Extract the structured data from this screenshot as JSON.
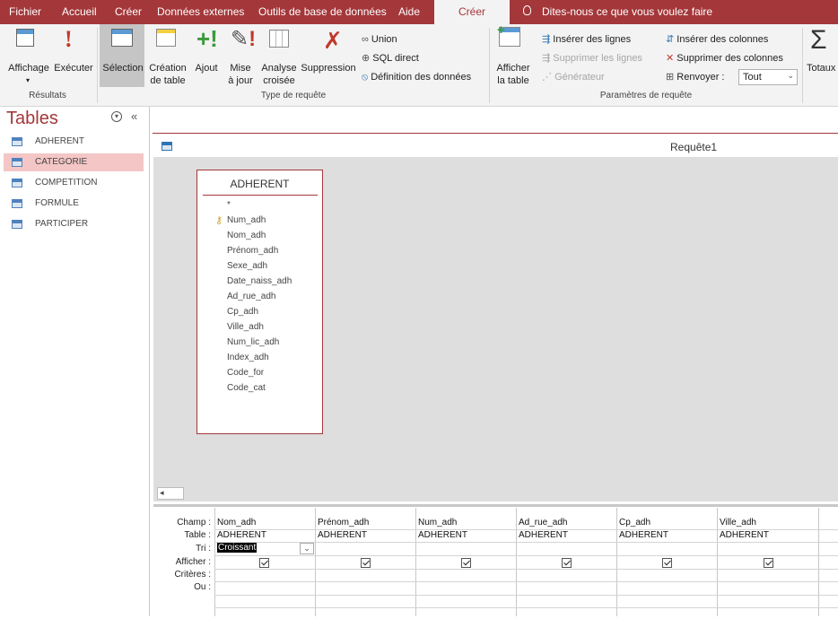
{
  "tabs": [
    "Fichier",
    "Accueil",
    "Créer",
    "Données externes",
    "Outils de base de données",
    "Aide",
    "Créer"
  ],
  "tellme": "Dites-nous ce que vous voulez faire",
  "ribbon": {
    "affichage": "Affichage",
    "executer": "Exécuter",
    "resultats": "Résultats",
    "selection": "Sélection",
    "creation": [
      "Création",
      "de table"
    ],
    "ajout": "Ajout",
    "miseajour": [
      "Mise",
      "à jour"
    ],
    "analyse": [
      "Analyse",
      "croisée"
    ],
    "suppression": "Suppression",
    "union": "Union",
    "sqldirect": "SQL direct",
    "definition": "Définition des données",
    "type_requete": "Type de requête",
    "afficher_table": [
      "Afficher",
      "la table"
    ],
    "inserer_lignes": "Insérer des lignes",
    "supprimer_lignes": "Supprimer les lignes",
    "generateur": "Générateur",
    "inserer_colonnes": "Insérer des colonnes",
    "supprimer_colonnes": "Supprimer des colonnes",
    "renvoyer": "Renvoyer :",
    "renvoyer_value": "Tout",
    "parametres": "Paramètres de requête",
    "totaux": "Totaux"
  },
  "nav": {
    "title": "Tables",
    "items": [
      "ADHERENT",
      "CATEGORIE",
      "COMPETITION",
      "FORMULE",
      "PARTICIPER"
    ]
  },
  "query_title": "Requête1",
  "table_box": {
    "name": "ADHERENT",
    "fields": [
      "*",
      "Num_adh",
      "Nom_adh",
      "Prénom_adh",
      "Sexe_adh",
      "Date_naiss_adh",
      "Ad_rue_adh",
      "Cp_adh",
      "Ville_adh",
      "Num_lic_adh",
      "Index_adh",
      "Code_for",
      "Code_cat"
    ]
  },
  "grid": {
    "row_labels": [
      "Champ :",
      "Table :",
      "Tri :",
      "Afficher :",
      "Critères :",
      "Ou :"
    ],
    "columns": [
      {
        "champ": "Nom_adh",
        "table": "ADHERENT",
        "tri": "Croissant"
      },
      {
        "champ": "Prénom_adh",
        "table": "ADHERENT",
        "tri": ""
      },
      {
        "champ": "Num_adh",
        "table": "ADHERENT",
        "tri": ""
      },
      {
        "champ": "Ad_rue_adh",
        "table": "ADHERENT",
        "tri": ""
      },
      {
        "champ": "Cp_adh",
        "table": "ADHERENT",
        "tri": ""
      },
      {
        "champ": "Ville_adh",
        "table": "ADHERENT",
        "tri": ""
      }
    ]
  },
  "colors": {
    "accent": "#a4373a",
    "selected_nav": "#f4c6c6"
  }
}
